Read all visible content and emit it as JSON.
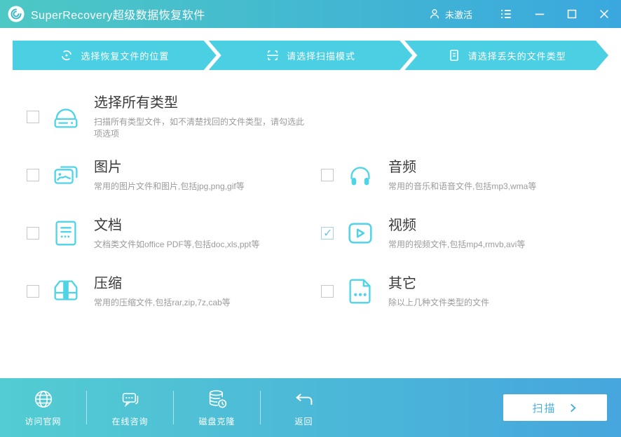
{
  "titlebar": {
    "title": "SuperRecovery超级数据恢复软件",
    "activation_label": "未激活"
  },
  "steps": [
    {
      "label": "选择恢复文件的位置",
      "icon": "sync-icon"
    },
    {
      "label": "请选择扫描模式",
      "icon": "scan-frame-icon"
    },
    {
      "label": "请选择丢失的文件类型",
      "icon": "file-icon"
    }
  ],
  "file_types": [
    {
      "id": "all",
      "title": "选择所有类型",
      "description": "扫描所有类型文件，如不清楚找回的文件类型，请勾选此项选项",
      "checked": false,
      "icon": "drive-icon"
    },
    {
      "id": "images",
      "title": "图片",
      "description": "常用的图片文件和图片,包括jpg,png,gif等",
      "checked": false,
      "icon": "image-icon"
    },
    {
      "id": "audio",
      "title": "音频",
      "description": "常用的音乐和语音文件,包括mp3,wma等",
      "checked": false,
      "icon": "headphones-icon"
    },
    {
      "id": "documents",
      "title": "文档",
      "description": "文档类文件如office PDF等,包括doc,xls,ppt等",
      "checked": false,
      "icon": "document-icon"
    },
    {
      "id": "video",
      "title": "视频",
      "description": "常用的视频文件,包括mp4,rmvb,avi等",
      "checked": true,
      "icon": "video-play-icon"
    },
    {
      "id": "archive",
      "title": "压缩",
      "description": "常用的压缩文件,包括rar,zip,7z,cab等",
      "checked": false,
      "icon": "archive-icon"
    },
    {
      "id": "other",
      "title": "其它",
      "description": "除以上几种文件类型的文件",
      "checked": false,
      "icon": "other-file-icon"
    }
  ],
  "footer": {
    "actions": [
      {
        "label": "访问官网",
        "icon": "globe-icon"
      },
      {
        "label": "在线咨询",
        "icon": "chat-icon"
      },
      {
        "label": "磁盘克隆",
        "icon": "disk-clone-icon"
      },
      {
        "label": "返回",
        "icon": "back-icon"
      }
    ],
    "scan_button_label": "扫描"
  },
  "colors": {
    "titlebar_gradient_start": "#4dc8c4",
    "titlebar_gradient_end": "#3aa8de",
    "footer_gradient_start": "#53ccd2",
    "footer_gradient_end": "#46a6dd",
    "step_background": "#4bcfe3",
    "accent_icon_cyan": "#4ed4e6",
    "scan_button_text": "#45b0dd",
    "title_text": "#3a3a3a",
    "description_text": "#9b9b9b"
  }
}
